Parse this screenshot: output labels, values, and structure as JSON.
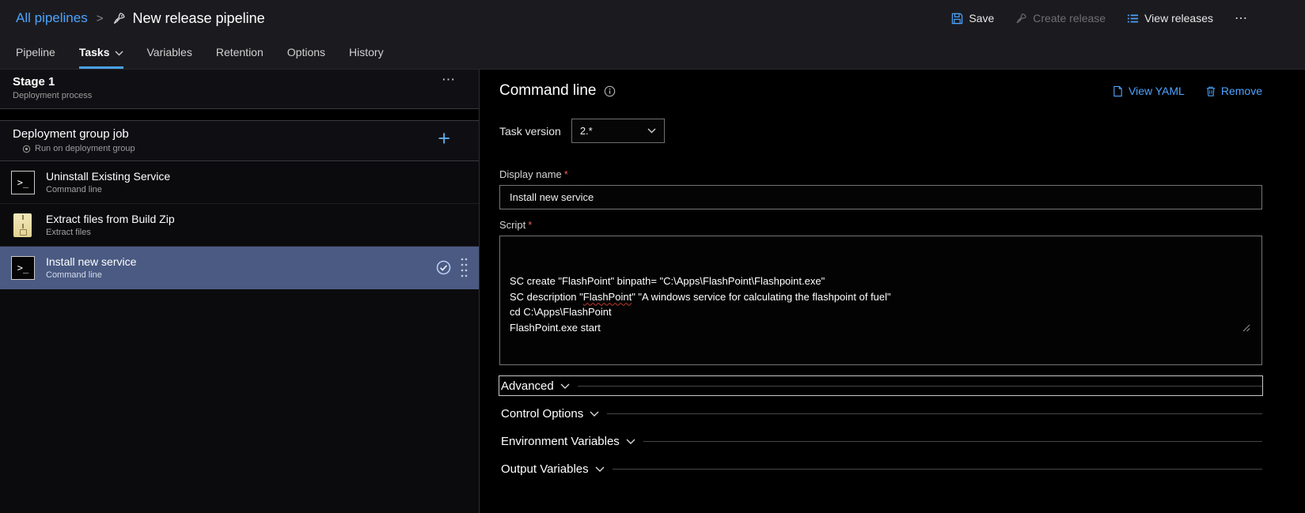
{
  "header": {
    "breadcrumb": "All pipelines",
    "separator": ">",
    "title": "New release pipeline",
    "save_label": "Save",
    "create_release_label": "Create release",
    "view_releases_label": "View releases",
    "more_label": "⋯"
  },
  "tabs": [
    {
      "label": "Pipeline"
    },
    {
      "label": "Tasks"
    },
    {
      "label": "Variables"
    },
    {
      "label": "Retention"
    },
    {
      "label": "Options"
    },
    {
      "label": "History"
    }
  ],
  "left_panel": {
    "stage_title": "Stage 1",
    "stage_subtitle": "Deployment process",
    "stage_more": "⋯",
    "job_title": "Deployment group job",
    "job_subtitle": "Run on deployment group",
    "job_add": "+",
    "tasks": [
      {
        "title": "Uninstall Existing Service",
        "subtitle": "Command line",
        "icon": "terminal-icon",
        "selected": false
      },
      {
        "title": "Extract files from Build Zip",
        "subtitle": "Extract files",
        "icon": "zip-icon",
        "selected": false
      },
      {
        "title": "Install new service",
        "subtitle": "Command line",
        "icon": "terminal-icon",
        "selected": true
      }
    ]
  },
  "main": {
    "title": "Command line",
    "view_yaml_label": "View YAML",
    "remove_label": "Remove",
    "task_version_label": "Task version",
    "task_version_value": "2.*",
    "display_name_label": "Display name",
    "display_name_required": "*",
    "display_name_value": "Install new service",
    "script_label": "Script",
    "script_required": "*",
    "script": {
      "lines": [
        "SC create \"FlashPoint\" binpath= \"C:\\Apps\\FlashPoint\\Flashpoint.exe\"",
        "SC description \"FlashPoint\" \"A windows service for calculating the flashpoint of fuel\"",
        "cd C:\\Apps\\FlashPoint",
        "FlashPoint.exe start"
      ],
      "spellcheck": {
        "line_index": 1,
        "word": "FlashPoint"
      }
    },
    "sections": [
      {
        "label": "Advanced",
        "focused": true
      },
      {
        "label": "Control Options",
        "focused": false
      },
      {
        "label": "Environment Variables",
        "focused": false
      },
      {
        "label": "Output Variables",
        "focused": false
      }
    ]
  },
  "colors": {
    "accent": "#4da3ff",
    "tab_underline": "#4ba0e8",
    "selected_row": "#4a5a82"
  }
}
